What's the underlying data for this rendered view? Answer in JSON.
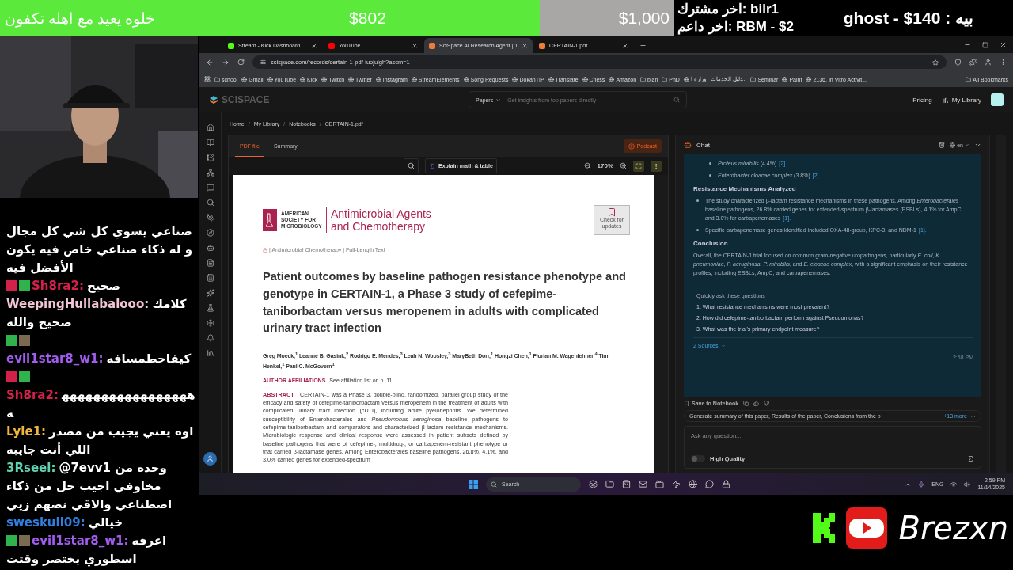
{
  "goal": {
    "title": "خلوه يعيد مع اهله تكفون",
    "current": "$802",
    "target": "$1,000",
    "level": 0.8
  },
  "recent": {
    "subscriber": "اخر مشترك: bilr1",
    "supporter": "اخر داعم: RBM - $2",
    "top": "ghost - $140 : بيه"
  },
  "stream_chat": [
    {
      "pen_badge": false,
      "sub_badge": false,
      "stick_badge": false,
      "text": "صناعي يسوي كل شي كل مجال و له ذكاء صناعي خاص فيه يكون الأفضل فيه"
    },
    {
      "user": "Sh8ra2:",
      "color": "#d3214a",
      "pen_badge": true,
      "sub_badge": true,
      "stick_badge": false,
      "text": "صحيح"
    },
    {
      "user": "WeepingHullabalooo:",
      "color": "#f1c6d6",
      "pen_badge": false,
      "sub_badge": false,
      "stick_badge": false,
      "text": "كلامك صحيح والله"
    },
    {
      "user": "evil1star8_w1:",
      "color": "#a35cf0",
      "pen_badge": false,
      "sub_badge": true,
      "stick_badge": true,
      "text": "كيفاحطمسافه"
    },
    {
      "user": "Sh8ra2:",
      "color": "#d3214a",
      "pen_badge": true,
      "sub_badge": true,
      "stick_badge": false,
      "text": "هههههههههههههههههه"
    },
    {
      "user": "Lyle1:",
      "color": "#f0b53c",
      "pen_badge": false,
      "sub_badge": false,
      "stick_badge": false,
      "text": "اوه يعني يجيب من مصدر اللي أنت جايبه"
    },
    {
      "user": "3Rseel:",
      "color": "#5fd3b0",
      "pen_badge": false,
      "sub_badge": false,
      "stick_badge": false,
      "text": "@7evv1 وحده من مخاوفي اجيب حل من ذكاء اصطناعي والاقي نصهم زيي"
    },
    {
      "user": "sweskull09:",
      "color": "#2f7fe0",
      "pen_badge": false,
      "sub_badge": false,
      "stick_badge": false,
      "text": "خيالي"
    },
    {
      "user": "evil1star8_w1:",
      "color": "#a35cf0",
      "pen_badge": false,
      "sub_badge": true,
      "stick_badge": true,
      "text": "اعرفه اسطوري يختصر وقتت"
    }
  ],
  "browser": {
    "tabs": [
      {
        "title": "Stream - Kick Dashboard",
        "color": "#53fc18",
        "selected": false
      },
      {
        "title": "YouTube",
        "color": "#ff0000",
        "selected": false
      },
      {
        "title": "SciSpace AI Research Agent | 1",
        "color": "#f07c3a",
        "selected": true
      },
      {
        "title": "CERTAIN-1.pdf",
        "color": "#f07c3a",
        "selected": false
      }
    ],
    "url": "scispace.com/records/certain-1-pdf-iuojulgh?ascm=1",
    "bookmarks": [
      {
        "label": "school",
        "kind": "folder"
      },
      {
        "label": "Gmail",
        "kind": "site"
      },
      {
        "label": "YouTube",
        "kind": "site"
      },
      {
        "label": "Kick",
        "kind": "site"
      },
      {
        "label": "Twitch",
        "kind": "site"
      },
      {
        "label": "Twitter",
        "kind": "site"
      },
      {
        "label": "Instagram",
        "kind": "site"
      },
      {
        "label": "StreamElements",
        "kind": "site"
      },
      {
        "label": "Song Requests",
        "kind": "site"
      },
      {
        "label": "DokanTIP",
        "kind": "site"
      },
      {
        "label": "Translate",
        "kind": "site"
      },
      {
        "label": "Chess",
        "kind": "site"
      },
      {
        "label": "Amazon",
        "kind": "site"
      },
      {
        "label": "blah",
        "kind": "folder"
      },
      {
        "label": "PhD",
        "kind": "folder"
      },
      {
        "label": "دليل الخدمات | وزارة ا...",
        "kind": "site"
      },
      {
        "label": "Seminar",
        "kind": "folder"
      },
      {
        "label": "Paint",
        "kind": "site"
      },
      {
        "label": "2136. In Vitro Activit...",
        "kind": "site"
      }
    ],
    "all_bookmarks": "All Bookmarks"
  },
  "app": {
    "logo": "SCISPACE",
    "search_scope": "Papers",
    "search_placeholder": "Get insights from top papers directly",
    "pricing": "Pricing",
    "library": "My Library",
    "breadcrumbs": [
      "Home",
      "/",
      "My Library",
      "/",
      "Notebooks",
      "/",
      "CERTAIN-1.pdf"
    ]
  },
  "pdf": {
    "tabs": [
      {
        "label": "PDF file",
        "selected": true
      },
      {
        "label": "Summary",
        "selected": false
      }
    ],
    "podcast": "Podcast",
    "explain": "Explain math & table",
    "zoom": "170%",
    "society": "AMERICAN SOCIETY FOR MICROBIOLOGY",
    "journal": "Antimicrobial Agents and Chemotherapy",
    "updates": "Check for updates",
    "section": "| Antimicrobial Chemotherapy | Full-Length Text",
    "title": "Patient outcomes by baseline pathogen resistance phenotype and genotype in CERTAIN-1, a Phase 3 study of cefepime-taniborbactam versus meropenem in adults with complicated urinary tract infection",
    "authors": "Greg Moeck,$^{1}$ Leanne B. Gasink,$^{2}$ Rodrigo E. Mendes,$^{3}$ Leah N. Woosley,$^{3}$ MaryBeth Dorr,$^{1}$ Hongzi Chen,$^{1}$ Florian M. Wagenlehner,$^{4}$ Tim Henkel,$^{1}$ Paul C. McGovern$^{1}$",
    "affiliations_label": "AUTHOR AFFILIATIONS",
    "affiliations": "See affiliation list on p. 11.",
    "abstract_label": "ABSTRACT",
    "abstract": "CERTAIN-1 was a Phase 3, double-blind, randomized, parallel group study of the efficacy and safety of cefepime-taniborbactam versus meropenem in the treatment of adults with complicated urinary tract infection (cUTI), including acute pyelonephritis. We determined susceptibility of Enterobacterales and *Pseudomonas aeruginosa* baseline pathogens to cefepime-taniborbactam and comparators and characterized β-lactam resistance mechanisms. Microbiologic response and clinical response were assessed in patient subsets defined by baseline pathogens that were of cefepime-, multidrug-, or carbapenem-resistant phenotype or that carried β-lactamase genes. Among Enterobacterales baseline pathogens, 26.8%, 4.1%, and 3.0% carried genes for extended-spectrum"
  },
  "chat": {
    "title": "Chat",
    "language": "en",
    "blocks": [
      {
        "kind": "bullet",
        "text": "*Proteus mirabilis* (4.4%)",
        "cite": "[2]"
      },
      {
        "kind": "bullet",
        "text": "*Enterobacter cloacae complex* (3.8%)",
        "cite": "[2]"
      },
      {
        "kind": "heading",
        "text": "Resistance Mechanisms Analyzed"
      },
      {
        "kind": "point",
        "text": "The study characterized β-lactam resistance mechanisms in these pathogens. Among *Enterobacterales* baseline pathogens, 26.8% carried genes for extended-spectrum β-lactamases (ESBLs), 4.1% for AmpC, and 3.0% for carbapenemases",
        "cite": "[1]."
      },
      {
        "kind": "point",
        "text": "Specific carbapenemase genes identified included OXA-48-group, KPC-3, and NDM-1",
        "cite": "[1]."
      },
      {
        "kind": "heading",
        "text": "Conclusion"
      },
      {
        "kind": "paragraph",
        "text": "Overall, the CERTAIN-1 trial focused on common gram-negative uropathogens, particularly *E. coli*, *K. pneumoniae*, *P. aeruginosa*, *P. mirabilis*, and *E. cloacae complex*, with a significant emphasis on their resistance profiles, including ESBLs, AmpC, and carbapenemases."
      }
    ],
    "questions_title": "Quickly ask these questions",
    "questions": [
      "1. What resistance mechanisms were most prevalent?",
      "2. How did cefepime-taniborbactam perform against Pseudomonas?",
      "3. What was the trial's primary endpoint measure?"
    ],
    "sources": "2 Sources",
    "time": "2:58 PM",
    "save": "Save to Notebook",
    "suggestion": "Generate summary of this paper, Results of the paper, Conclusions from the p",
    "more": "+13 more",
    "placeholder": "Ask any question...",
    "high_quality": {
      "label": "High Quality",
      "on": false
    }
  },
  "taskbar": {
    "search": "Search",
    "language": "ENG",
    "time": "2:59 PM",
    "date": "11/14/2025"
  },
  "brand": "Brezxn"
}
